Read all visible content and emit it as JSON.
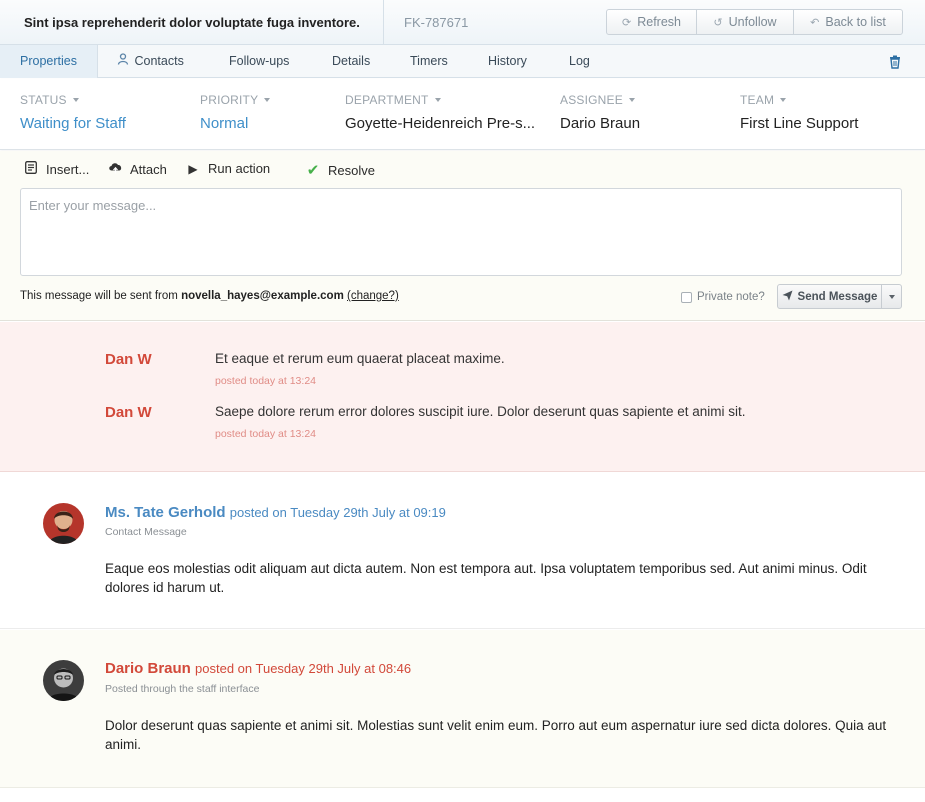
{
  "ticket": {
    "subject": "Sint ipsa reprehenderit dolor voluptate fuga inventore.",
    "ref": "FK-787671"
  },
  "actions": {
    "refresh": "Refresh",
    "unfollow": "Unfollow",
    "back": "Back to list"
  },
  "tabs": [
    {
      "label": "Properties",
      "active": true
    },
    {
      "label": "Contacts",
      "icon": "contacts-icon"
    },
    {
      "label": "Follow-ups"
    },
    {
      "label": "Details"
    },
    {
      "label": "Timers"
    },
    {
      "label": "History"
    },
    {
      "label": "Log"
    }
  ],
  "properties": [
    {
      "label": "STATUS",
      "value": "Waiting for Staff"
    },
    {
      "label": "PRIORITY",
      "value": "Normal"
    },
    {
      "label": "DEPARTMENT",
      "value": "Goyette-Heidenreich Pre-s..."
    },
    {
      "label": "ASSIGNEE",
      "value": "Dario Braun"
    },
    {
      "label": "TEAM",
      "value": "First Line Support"
    }
  ],
  "toolbar": {
    "insert": "Insert...",
    "attach": "Attach",
    "run_action": "Run action",
    "resolve": "Resolve"
  },
  "reply": {
    "placeholder": "Enter your message...",
    "from_prefix": "This message will be sent from",
    "from_email": "novella_hayes@example.com",
    "change": "(change?)",
    "private_note": "Private note?",
    "send": "Send Message"
  },
  "notes": [
    {
      "author": "Dan W",
      "text": "Et eaque et rerum eum quaerat placeat maxime.",
      "stamp": "posted today at 13:24"
    },
    {
      "author": "Dan W",
      "text": "Saepe dolore rerum error dolores suscipit iure. Dolor deserunt quas sapiente et animi sit.",
      "stamp": "posted today at 13:24"
    }
  ],
  "messages": [
    {
      "author": "Ms. Tate Gerhold",
      "when": "posted on Tuesday 29th July at 09:19",
      "via": "Contact Message",
      "body": "Eaque eos molestias odit aliquam aut dicta autem. Non est tempora aut. Ipsa voluptatem temporibus sed. Aut animi minus. Odit dolores id harum ut."
    },
    {
      "author": "Dario Braun",
      "when": "posted on Tuesday 29th July at 08:46",
      "via": "Posted through the staff interface",
      "body": "Dolor deserunt quas sapiente et animi sit. Molestias sunt velit enim eum. Porro aut eum aspernatur iure sed dicta dolores. Quia aut animi."
    }
  ],
  "colors": {
    "accent": "#3f8fc9",
    "staff": "#d2493a",
    "resolve": "#46b04a"
  }
}
